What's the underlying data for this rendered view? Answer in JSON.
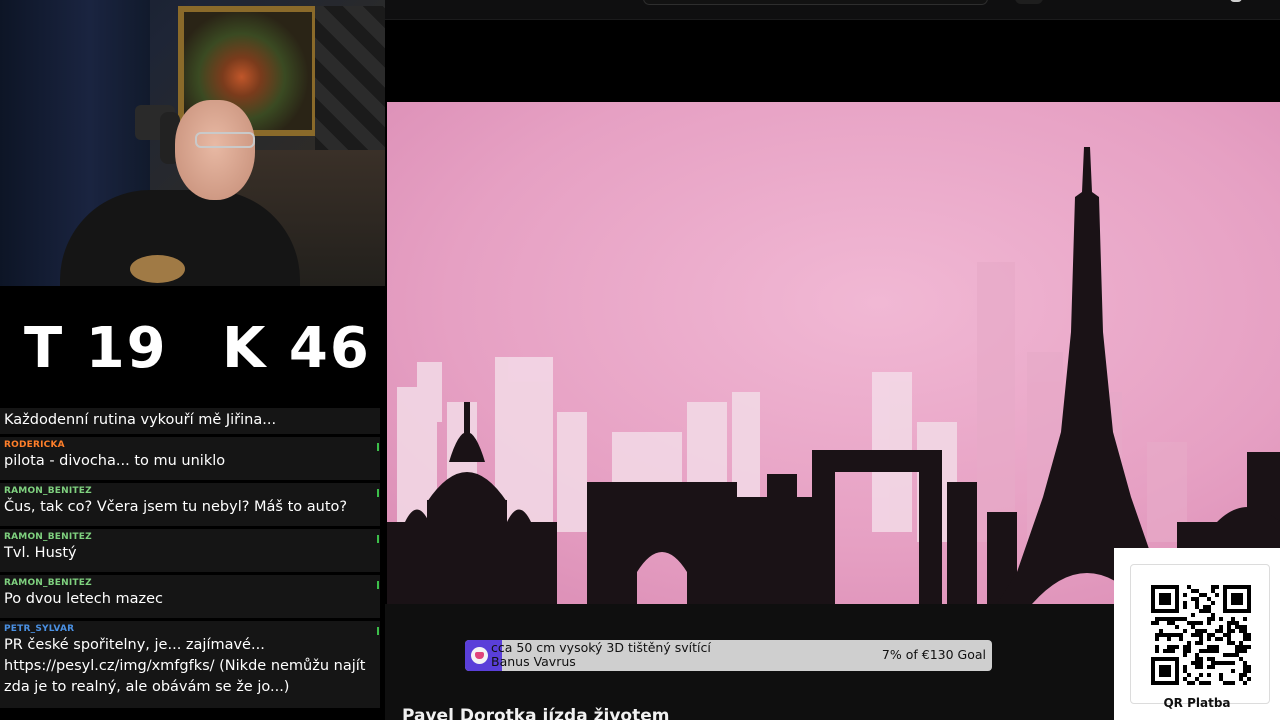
{
  "counters": {
    "t_label": "T 19",
    "k_label": "K 46"
  },
  "chat": {
    "colors": {
      "roderick": "#ff7f2a",
      "ramon": "#7fd17f",
      "petr": "#4a90e2"
    },
    "messages": [
      {
        "user": "",
        "text": "Každodenní rutina vykouří mě Jiřina..."
      },
      {
        "user": "RODERICKA",
        "text": "pilota - divocha... to mu uniklo"
      },
      {
        "user": "RAMON_BENITEZ",
        "text": "Čus, tak co? Včera jsem tu nebyl? Máš to auto?"
      },
      {
        "user": "RAMON_BENITEZ",
        "text": "Tvl. Hustý"
      },
      {
        "user": "RAMON_BENITEZ",
        "text": "Po dvou letech mazec"
      },
      {
        "user": "PETR_SYLVAR",
        "text": "PR české spořitelny, je... zajímavé...\nhttps://pesyl.cz/img/xmfgfks/ (Nikde nemůžu najít zda je to realný, ale obávám se že jo...)"
      }
    ]
  },
  "goal": {
    "line1": "cca 50 cm vysoký 3D tištěný svítící",
    "line2": "Banus Vavrus",
    "progress_text": "7% of €130 Goal",
    "progress_fraction": 0.07,
    "fill_color": "#5a3fd9",
    "bg_color": "#cfcfcf"
  },
  "video": {
    "title": "Pavel Dorotka jízda životem"
  },
  "qr": {
    "label": "QR Platba"
  }
}
